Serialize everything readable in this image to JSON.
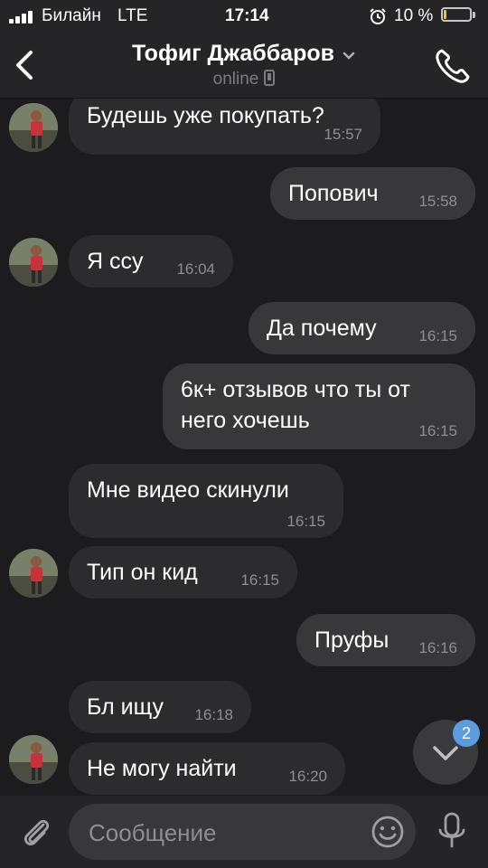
{
  "status_bar": {
    "carrier": "Билайн",
    "network": "LTE",
    "time": "17:14",
    "battery": "10 %",
    "battery_fill_percent": 10,
    "battery_color": "#f4c21a"
  },
  "header": {
    "contact_name": "Тофиг Джаббаров",
    "status": "online",
    "back_icon": "chevron-left-icon",
    "call_icon": "phone-icon"
  },
  "messages": [
    {
      "direction": "in",
      "text": "Будешь уже покупать?",
      "time": "15:57"
    },
    {
      "direction": "out",
      "text": "Попович",
      "time": "15:58"
    },
    {
      "direction": "in",
      "text": "Я ссу",
      "time": "16:04"
    },
    {
      "direction": "out",
      "text": "Да почему",
      "time": "16:15"
    },
    {
      "direction": "out",
      "text_line1": "6к+ отзывов что ты от",
      "text_line2": "него хочешь",
      "time": "16:15"
    },
    {
      "direction": "in",
      "text": "Мне видео скинули",
      "time": "16:15"
    },
    {
      "direction": "in",
      "text": "Тип он кид",
      "time": "16:15"
    },
    {
      "direction": "out",
      "text": "Пруфы",
      "time": "16:16"
    },
    {
      "direction": "in",
      "text": "Бл ищу",
      "time": "16:18"
    },
    {
      "direction": "in",
      "text": "Не могу найти",
      "time": "16:20"
    }
  ],
  "scroll_down": {
    "unread_count": "2",
    "badge_color": "#5b9cde"
  },
  "composer": {
    "placeholder": "Сообщение",
    "value": ""
  },
  "colors": {
    "background": "#1c1c1e",
    "incoming_bubble": "#2c2c2e",
    "outgoing_bubble": "#38383a",
    "accent": "#5b9cde"
  }
}
